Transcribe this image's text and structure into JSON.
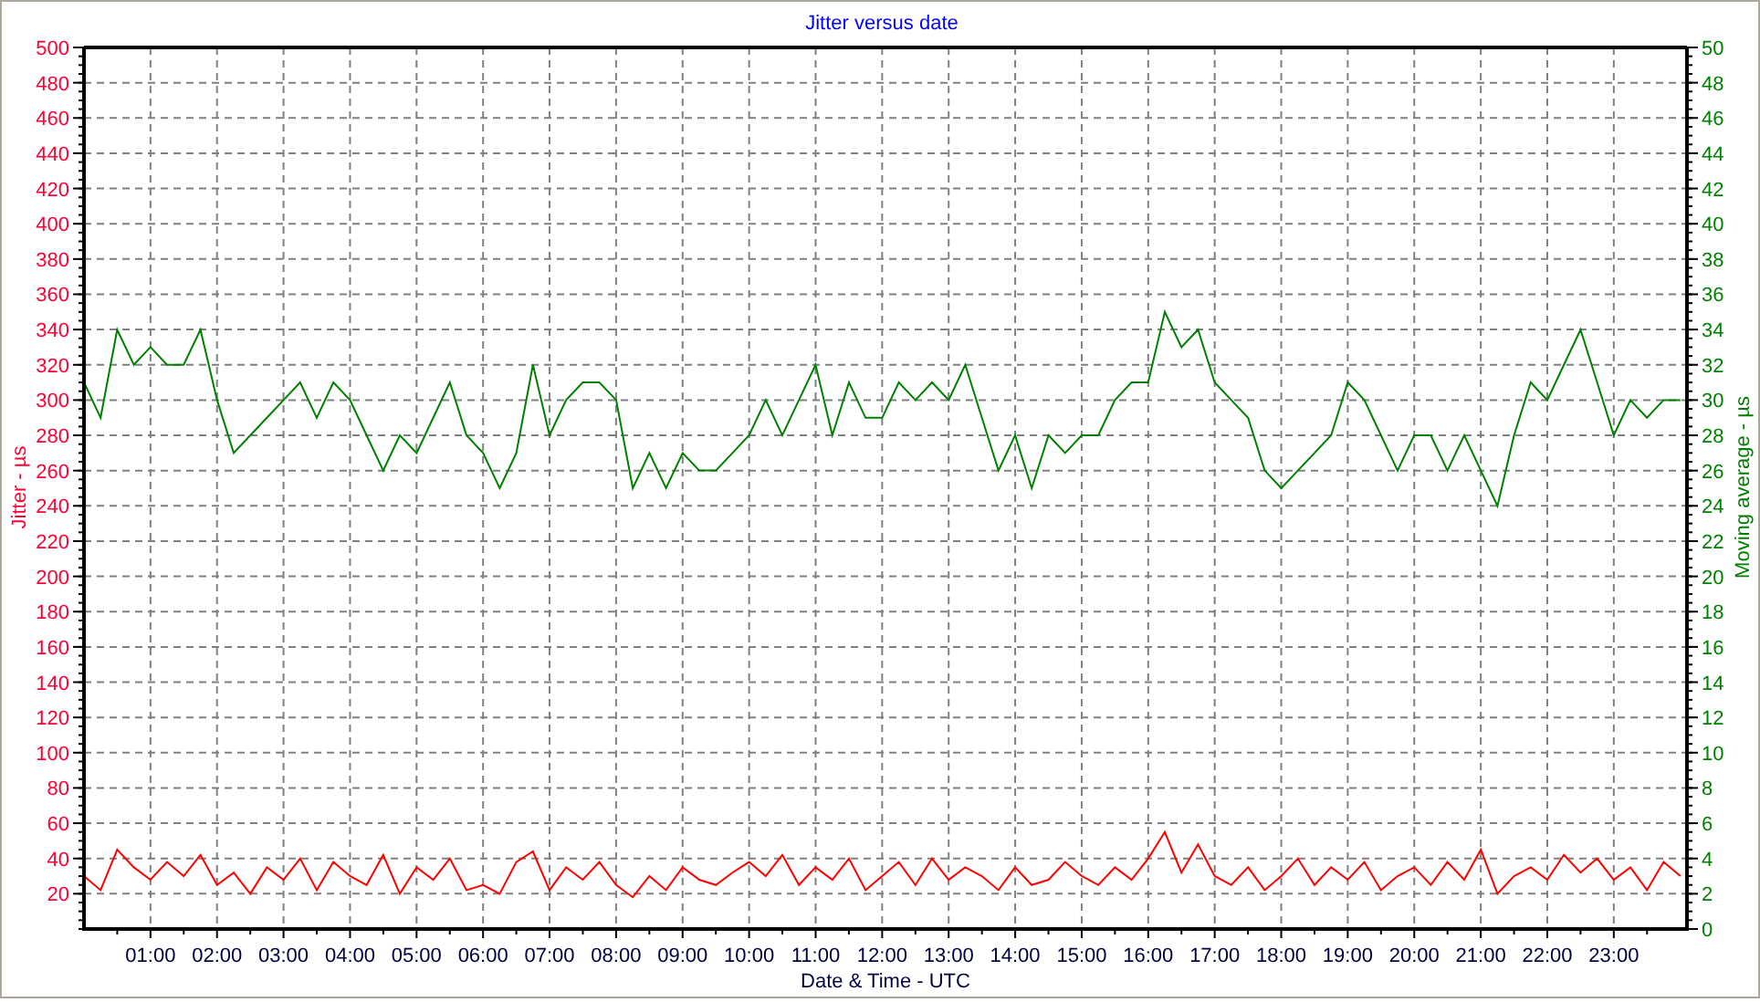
{
  "chart_data": {
    "type": "line",
    "title": "Jitter versus date",
    "xlabel": "Date & Time - UTC",
    "ylabel": "Jitter - µs",
    "y2label": "Moving average - µs",
    "grid": true,
    "xlim": [
      0,
      24.1
    ],
    "ylim": [
      0,
      500
    ],
    "y2lim": [
      0,
      50
    ],
    "xticks": [
      {
        "value": 1,
        "label": "01:00"
      },
      {
        "value": 2,
        "label": "02:00"
      },
      {
        "value": 3,
        "label": "03:00"
      },
      {
        "value": 4,
        "label": "04:00"
      },
      {
        "value": 5,
        "label": "05:00"
      },
      {
        "value": 6,
        "label": "06:00"
      },
      {
        "value": 7,
        "label": "07:00"
      },
      {
        "value": 8,
        "label": "08:00"
      },
      {
        "value": 9,
        "label": "09:00"
      },
      {
        "value": 10,
        "label": "10:00"
      },
      {
        "value": 11,
        "label": "11:00"
      },
      {
        "value": 12,
        "label": "12:00"
      },
      {
        "value": 13,
        "label": "13:00"
      },
      {
        "value": 14,
        "label": "14:00"
      },
      {
        "value": 15,
        "label": "15:00"
      },
      {
        "value": 16,
        "label": "16:00"
      },
      {
        "value": 17,
        "label": "17:00"
      },
      {
        "value": 18,
        "label": "18:00"
      },
      {
        "value": 19,
        "label": "19:00"
      },
      {
        "value": 20,
        "label": "20:00"
      },
      {
        "value": 21,
        "label": "21:00"
      },
      {
        "value": 22,
        "label": "22:00"
      },
      {
        "value": 23,
        "label": "23:00"
      }
    ],
    "yticks": [
      20,
      40,
      60,
      80,
      100,
      120,
      140,
      160,
      180,
      200,
      220,
      240,
      260,
      280,
      300,
      320,
      340,
      360,
      380,
      400,
      420,
      440,
      460,
      480,
      500
    ],
    "y2ticks": [
      0,
      2,
      4,
      6,
      8,
      10,
      12,
      14,
      16,
      18,
      20,
      22,
      24,
      26,
      28,
      30,
      32,
      34,
      36,
      38,
      40,
      42,
      44,
      46,
      48,
      50
    ],
    "x": [
      0,
      0.25,
      0.5,
      0.75,
      1,
      1.25,
      1.5,
      1.75,
      2,
      2.25,
      2.5,
      2.75,
      3,
      3.25,
      3.5,
      3.75,
      4,
      4.25,
      4.5,
      4.75,
      5,
      5.25,
      5.5,
      5.75,
      6,
      6.25,
      6.5,
      6.75,
      7,
      7.25,
      7.5,
      7.75,
      8,
      8.25,
      8.5,
      8.75,
      9,
      9.25,
      9.5,
      9.75,
      10,
      10.25,
      10.5,
      10.75,
      11,
      11.25,
      11.5,
      11.75,
      12,
      12.25,
      12.5,
      12.75,
      13,
      13.25,
      13.5,
      13.75,
      14,
      14.25,
      14.5,
      14.75,
      15,
      15.25,
      15.5,
      15.75,
      16,
      16.25,
      16.5,
      16.75,
      17,
      17.25,
      17.5,
      17.75,
      18,
      18.25,
      18.5,
      18.75,
      19,
      19.25,
      19.5,
      19.75,
      20,
      20.25,
      20.5,
      20.75,
      21,
      21.25,
      21.5,
      21.75,
      22,
      22.25,
      22.5,
      22.75,
      23,
      23.25,
      23.5,
      23.75,
      24
    ],
    "series": [
      {
        "color": "#ff0000",
        "axis": "y",
        "values": [
          30,
          22,
          45,
          35,
          28,
          38,
          30,
          42,
          25,
          32,
          20,
          35,
          28,
          40,
          22,
          38,
          30,
          25,
          42,
          20,
          35,
          28,
          40,
          22,
          25,
          20,
          38,
          44,
          22,
          35,
          28,
          38,
          25,
          18,
          30,
          22,
          35,
          28,
          25,
          32,
          38,
          30,
          42,
          25,
          35,
          28,
          40,
          22,
          30,
          38,
          25,
          40,
          28,
          35,
          30,
          22,
          35,
          25,
          28,
          38,
          30,
          25,
          35,
          28,
          40,
          55,
          32,
          48,
          30,
          25,
          35,
          22,
          30,
          40,
          25,
          35,
          28,
          38,
          22,
          30,
          35,
          25,
          38,
          28,
          45,
          20,
          30,
          35,
          28,
          42,
          32,
          40,
          28,
          35,
          22,
          38,
          30
        ]
      },
      {
        "color": "#008000",
        "axis": "y2",
        "values": [
          31,
          29,
          34,
          32,
          33,
          32,
          32,
          34,
          30,
          27,
          28,
          29,
          30,
          31,
          29,
          31,
          30,
          28,
          26,
          28,
          27,
          29,
          31,
          28,
          27,
          25,
          27,
          32,
          28,
          30,
          31,
          31,
          30,
          25,
          27,
          25,
          27,
          26,
          26,
          27,
          28,
          30,
          28,
          30,
          32,
          28,
          31,
          29,
          29,
          31,
          30,
          31,
          30,
          32,
          29,
          26,
          28,
          25,
          28,
          27,
          28,
          28,
          30,
          31,
          31,
          35,
          33,
          34,
          31,
          30,
          29,
          26,
          25,
          26,
          27,
          28,
          31,
          30,
          28,
          26,
          28,
          28,
          26,
          28,
          26,
          24,
          28,
          31,
          30,
          32,
          34,
          31,
          28,
          30,
          29,
          30,
          30
        ]
      }
    ]
  }
}
